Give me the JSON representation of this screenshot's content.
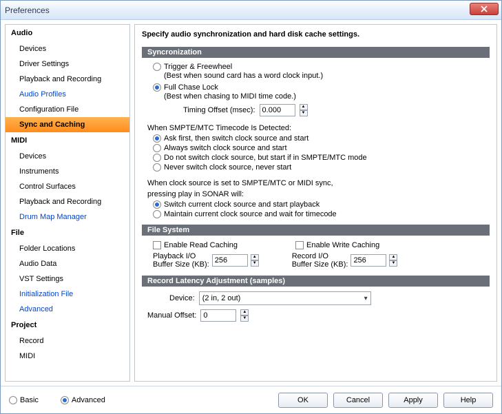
{
  "window": {
    "title": "Preferences"
  },
  "sidebar": {
    "categories": [
      {
        "label": "Audio",
        "items": [
          {
            "label": "Devices"
          },
          {
            "label": "Driver Settings"
          },
          {
            "label": "Playback and Recording"
          },
          {
            "label": "Audio Profiles",
            "link": true
          },
          {
            "label": "Configuration File"
          },
          {
            "label": "Sync and Caching",
            "selected": true
          }
        ]
      },
      {
        "label": "MIDI",
        "items": [
          {
            "label": "Devices"
          },
          {
            "label": "Instruments"
          },
          {
            "label": "Control Surfaces"
          },
          {
            "label": "Playback and Recording"
          },
          {
            "label": "Drum Map Manager",
            "link": true
          }
        ]
      },
      {
        "label": "File",
        "items": [
          {
            "label": "Folder Locations"
          },
          {
            "label": "Audio Data"
          },
          {
            "label": "VST Settings"
          },
          {
            "label": "Initialization File",
            "link": true
          },
          {
            "label": "Advanced",
            "link": true
          }
        ]
      },
      {
        "label": "Project",
        "items": [
          {
            "label": "Record"
          },
          {
            "label": "MIDI"
          }
        ]
      }
    ]
  },
  "main": {
    "header": "Specify audio synchronization and hard disk cache settings.",
    "sync": {
      "title": "Syncronization",
      "opt1": "Trigger & Freewheel",
      "hint1": "(Best when sound card has a word clock input.)",
      "opt2": "Full Chase Lock",
      "hint2": "(Best when chasing to MIDI time code.)",
      "offset_label": "Timing Offset (msec):",
      "offset_value": "0.000",
      "smpte_label": "When SMPTE/MTC Timecode Is Detected:",
      "smpte_opts": [
        "Ask first, then switch clock source and start",
        "Always switch clock source and start",
        "Do not switch clock source, but start if in SMPTE/MTC mode",
        "Never switch clock source, never start"
      ],
      "play_label1": "When clock source is set to SMPTE/MTC or MIDI sync,",
      "play_label2": "pressing play in SONAR will:",
      "play_opts": [
        "Switch current clock source and start playback",
        "Maintain current clock source and wait for timecode"
      ]
    },
    "fs": {
      "title": "File System",
      "read": "Enable Read Caching",
      "write": "Enable Write Caching",
      "pb_label1": "Playback I/O",
      "pb_label2": "Buffer Size (KB):",
      "pb_value": "256",
      "rec_label1": "Record I/O",
      "rec_label2": "Buffer Size (KB):",
      "rec_value": "256"
    },
    "latency": {
      "title": "Record Latency Adjustment (samples)",
      "device_label": "Device:",
      "device_value": "(2 in, 2 out)",
      "manual_label": "Manual Offset:",
      "manual_value": "0"
    }
  },
  "footer": {
    "basic": "Basic",
    "advanced": "Advanced",
    "ok": "OK",
    "cancel": "Cancel",
    "apply": "Apply",
    "help": "Help"
  }
}
